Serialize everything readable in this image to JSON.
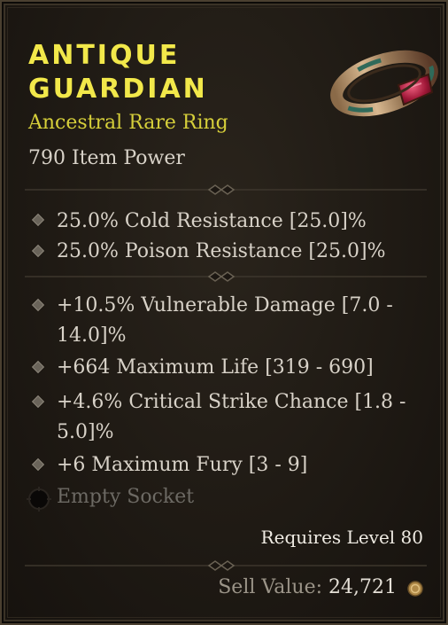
{
  "item": {
    "name_line1": "ANTIQUE",
    "name_line2": "GUARDIAN",
    "type": "Ancestral Rare Ring",
    "item_power": "790 Item Power",
    "icon": "ring-icon"
  },
  "implicit_affixes": [
    {
      "text": "25.0% Cold Resistance [25.0]%"
    },
    {
      "text": "25.0% Poison Resistance [25.0]%"
    }
  ],
  "affixes": [
    {
      "line1": "+10.5% Vulnerable Damage [7.0 -",
      "line2": "14.0]%"
    },
    {
      "line1": "+664 Maximum Life [319 - 690]",
      "line2": ""
    },
    {
      "line1": "+4.6% Critical Strike Chance [1.8 -",
      "line2": "5.0]%"
    },
    {
      "line1": "+6 Maximum Fury [3 - 9]",
      "line2": ""
    }
  ],
  "socket": {
    "label": "Empty Socket",
    "icon": "empty-socket-icon"
  },
  "requirement": "Requires Level 80",
  "sell": {
    "label": "Sell Value:",
    "value": "24,721",
    "icon": "gold-coin-icon"
  },
  "colors": {
    "title": "#f2e84a",
    "rarity": "#d6cf3a",
    "text": "#d8d2c8",
    "disabled": "#6d6a64"
  }
}
